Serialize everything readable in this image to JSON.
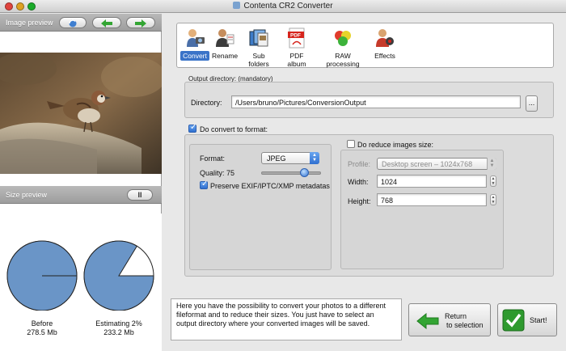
{
  "window": {
    "title": "Contenta CR2 Converter"
  },
  "left": {
    "image_preview_label": "Image preview",
    "size_preview_label": "Size preview",
    "nav_buttons": [
      "refresh-icon",
      "arrow-left-icon",
      "arrow-right-icon"
    ],
    "pause_glyph": "II",
    "before": {
      "label": "Before",
      "value": "278.5 Mb",
      "fraction": 1.0
    },
    "after": {
      "label": "Estimating 2%",
      "value": "233.2 Mb",
      "fraction": 0.837
    }
  },
  "toolbar": {
    "tools": [
      {
        "label": "Convert",
        "icon": "person-camera-icon",
        "active": true
      },
      {
        "label": "Rename",
        "icon": "person-document-icon",
        "active": false
      },
      {
        "label": "Sub folders",
        "icon": "folders-icon",
        "active": false
      },
      {
        "label": "PDF album",
        "icon": "pdf-icon",
        "active": false
      },
      {
        "label": "RAW processing",
        "icon": "colored-spheres-icon",
        "active": false
      },
      {
        "label": "Effects",
        "icon": "person-effects-icon",
        "active": false
      }
    ]
  },
  "output": {
    "section_label": "Output directory: (mandatory)",
    "directory_label": "Directory:",
    "directory_value": "/Users/bruno/Pictures/ConversionOutput",
    "browse_label": "..."
  },
  "convert": {
    "checkbox_label": "Do convert to format:",
    "checked": true,
    "format_label": "Format:",
    "format_value": "JPEG",
    "quality_label": "Quality: 75",
    "quality_value": 75,
    "preserve_label": "Preserve EXIF/IPTC/XMP metadatas",
    "preserve_checked": true
  },
  "reduce": {
    "checkbox_label": "Do reduce images size:",
    "checked": false,
    "profile_label": "Profile:",
    "profile_value": "Desktop screen – 1024x768",
    "width_label": "Width:",
    "width_value": "1024",
    "height_label": "Height:",
    "height_value": "768"
  },
  "description": "Here you have the possibility to convert your photos to a different fileformat and to reduce their sizes. You just have to select an output directory where your converted images will be saved.",
  "buttons": {
    "return_line1": "Return",
    "return_line2": "to selection",
    "start": "Start!"
  },
  "colors": {
    "pie_fill": "#6a95c7",
    "active_tool": "#3a73c8",
    "start_green": "#2e9a2e",
    "arrow_green": "#33a533"
  }
}
